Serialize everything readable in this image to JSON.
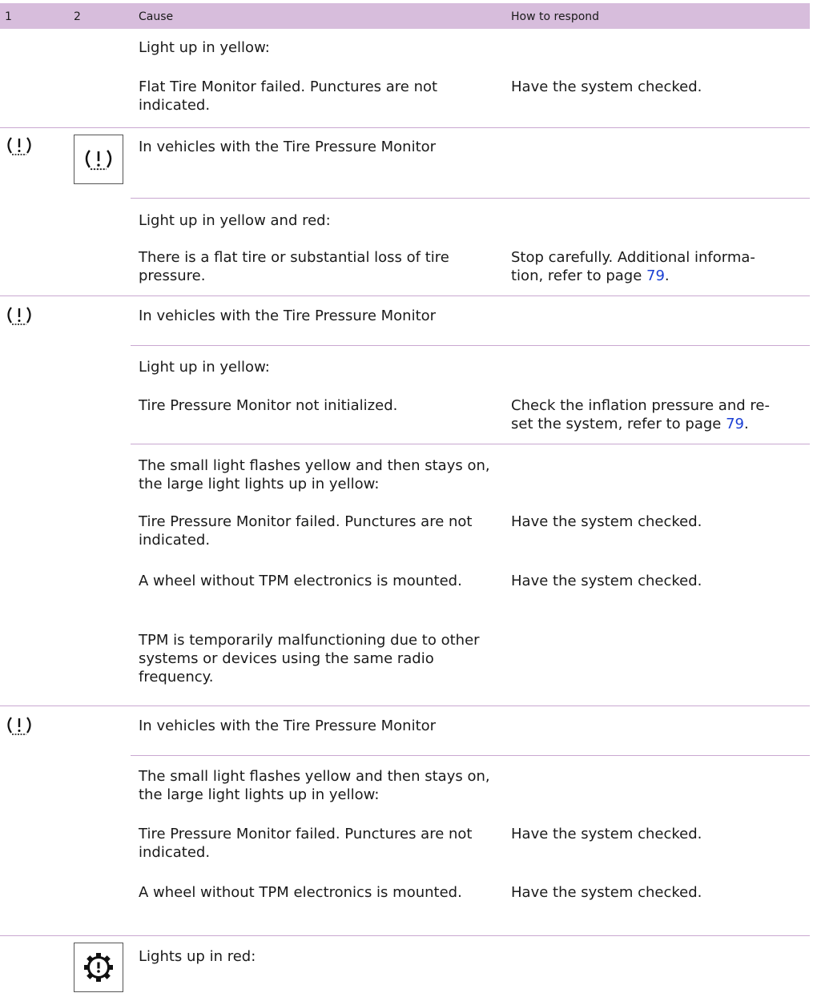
{
  "header": {
    "col1": "1",
    "col2": "2",
    "col_cause": "Cause",
    "col_respond": "How to respond"
  },
  "rows": {
    "r1": "Light up in yellow:",
    "r2_cause": "Flat Tire Monitor failed. Punctures are not indicated.",
    "r2_resp": "Have the system checked.",
    "r3": "In vehicles with the Tire Pressure Monitor",
    "r4": "Light up in yellow and red:",
    "r5_cause": "There is a flat tire or substantial loss of tire pressure.",
    "r5_resp_a": "Stop carefully. Additional informa-",
    "r5_resp_b": "tion, refer to page ",
    "r5_page": "79",
    "r6": "In vehicles with the Tire Pressure Monitor",
    "r7": "Light up in yellow:",
    "r8_cause": "Tire Pressure Monitor not initialized.",
    "r8_resp_a": "Check the inflation pressure and re-",
    "r8_resp_b": "set the system, refer to page ",
    "r8_page": "79",
    "r9": "The small light flashes yellow and then stays on, the large light lights up in yellow:",
    "r10_cause": "Tire Pressure Monitor failed. Punctures are not indicated.",
    "r10_resp": "Have the system checked.",
    "r11_cause": "A wheel without TPM electronics is mounted.",
    "r11_resp": "Have the system checked.",
    "r12_cause": "TPM is temporarily malfunctioning due to other systems or devices using the same radio frequency.",
    "r13": "In vehicles with the Tire Pressure Monitor",
    "r14": "The small light flashes yellow and then stays on, the large light lights up in yellow:",
    "r15_cause": "Tire Pressure Monitor failed. Punctures are not indicated.",
    "r15_resp": "Have the system checked.",
    "r16_cause": "A wheel without TPM electronics is mounted.",
    "r16_resp": "Have the system checked.",
    "r17": "Lights up in red:"
  },
  "icons": {
    "tpm": "tire-pressure-warning-icon",
    "transmission": "transmission-warning-icon"
  }
}
